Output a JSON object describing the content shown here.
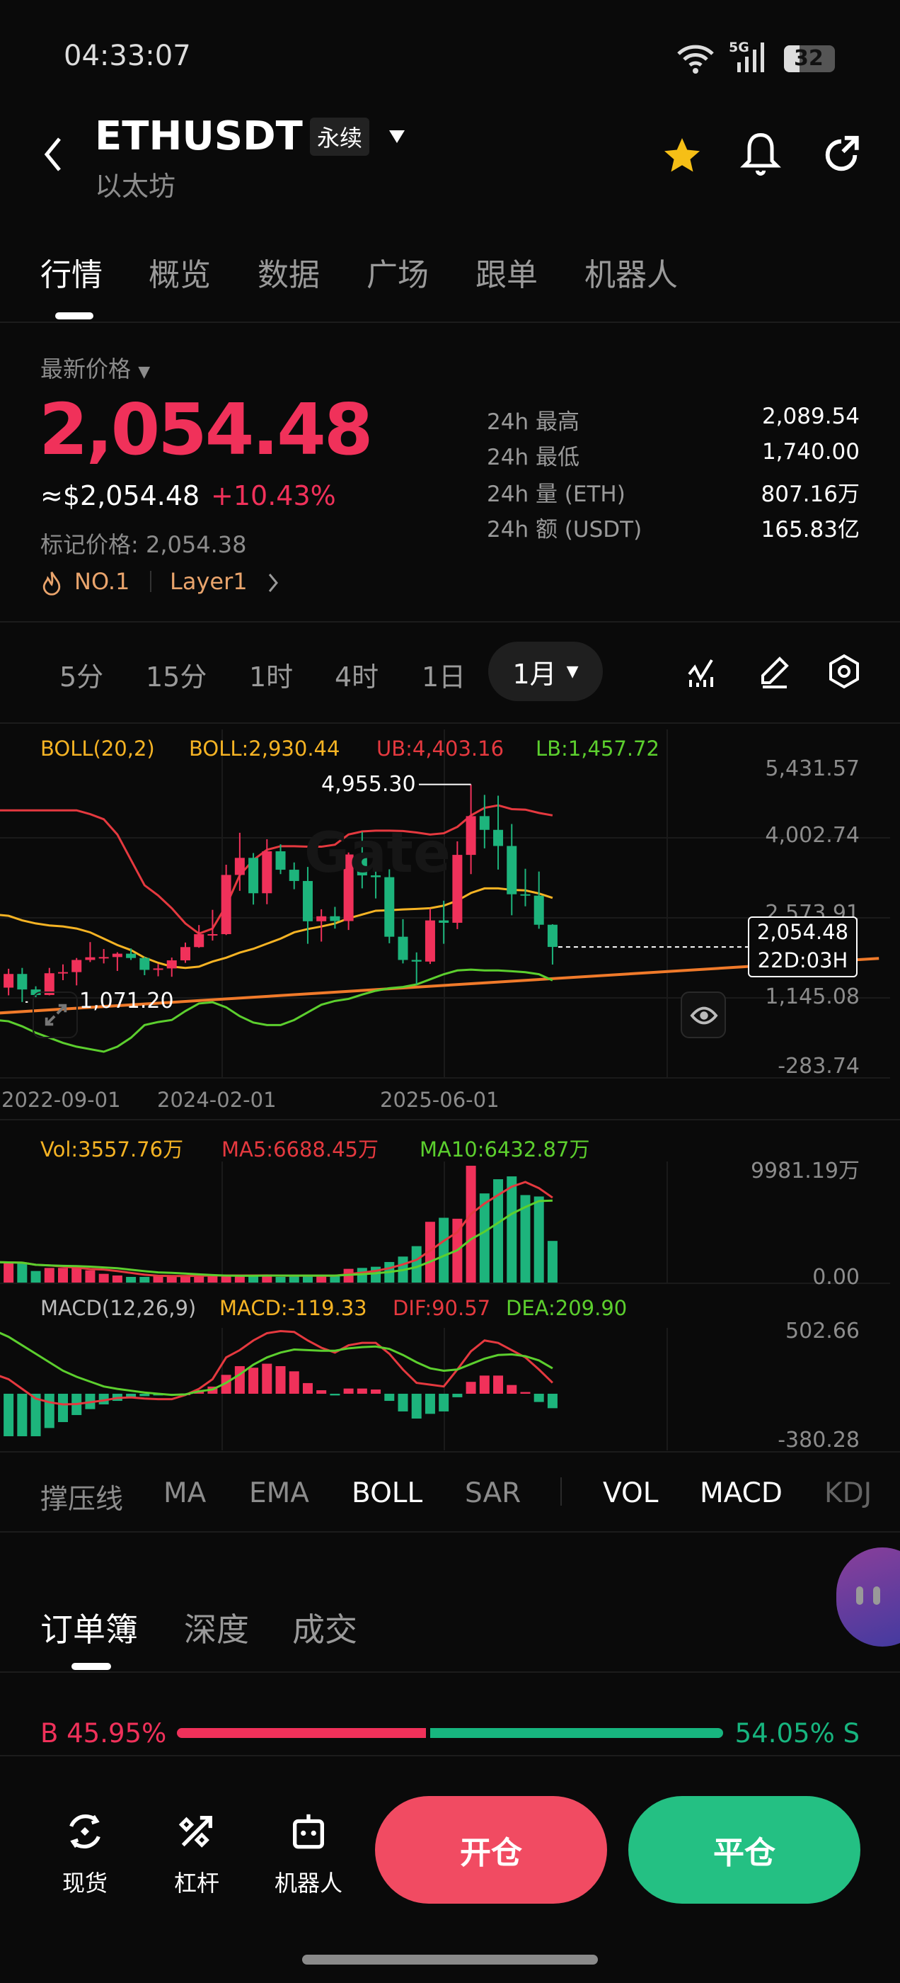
{
  "status_bar": {
    "time": "04:33:07",
    "network": "5G",
    "battery": "32"
  },
  "header": {
    "symbol": "ETHUSDT",
    "contract_type": "永续",
    "name": "以太坊",
    "favorited": true
  },
  "tabs": [
    {
      "label": "行情",
      "active": true
    },
    {
      "label": "概览"
    },
    {
      "label": "数据"
    },
    {
      "label": "广场"
    },
    {
      "label": "跟单"
    },
    {
      "label": "机器人"
    }
  ],
  "price": {
    "label": "最新价格",
    "last": "2,054.48",
    "usd": "≈$2,054.48",
    "change": "+10.43%",
    "mark_label": "标记价格: 2,054.38",
    "rank": "NO.1",
    "category": "Layer1",
    "stats": [
      {
        "label": "24h  最高",
        "value": "2,089.54"
      },
      {
        "label": "24h  最低",
        "value": "1,740.00"
      },
      {
        "label": "24h  量 (ETH)",
        "value": "807.16万"
      },
      {
        "label": "24h  额 (USDT)",
        "value": "165.83亿"
      }
    ]
  },
  "intervals": {
    "items": [
      "5分",
      "15分",
      "1时",
      "4时",
      "1日"
    ],
    "selected": "1月"
  },
  "chart_legend": {
    "boll_name": "BOLL(20,2)",
    "boll": "BOLL:2,930.44",
    "ub": "UB:4,403.16",
    "lb": "LB:1,457.72",
    "vol": "Vol:3557.76万",
    "ma5": "MA5:6688.45万",
    "ma10": "MA10:6432.87万",
    "macd_name": "MACD(12,26,9)",
    "macd": "MACD:-119.33",
    "dif": "DIF:90.57",
    "dea": "DEA:209.90"
  },
  "chart_annotations": {
    "high": "4,955.30",
    "low": "1,071.20",
    "current_price": "2,054.48",
    "countdown": "22D:03H",
    "watermark": "Gate"
  },
  "colors": {
    "up": "#f0315a",
    "down": "#1db47c",
    "ub": "#e5393f",
    "mid": "#f5b324",
    "lb": "#5ccf2e",
    "trend": "#f07a2a",
    "ma5": "#e5393f",
    "ma10": "#5ccf2e",
    "accent_orange": "#e9a46c"
  },
  "chart_data": {
    "type": "candlestick",
    "interval": "1月",
    "price_axis_ticks": [
      "5,431.57",
      "4,002.74",
      "2,573.91",
      "1,145.08",
      "-283.74"
    ],
    "ylim": [
      -283.74,
      5431.57
    ],
    "x_tick_labels": [
      "2022-09-01",
      "2024-02-01",
      "2025-06-01"
    ],
    "dates": [
      "2022-09",
      "2022-10",
      "2022-11",
      "2022-12",
      "2023-01",
      "2023-02",
      "2023-03",
      "2023-04",
      "2023-05",
      "2023-06",
      "2023-07",
      "2023-08",
      "2023-09",
      "2023-10",
      "2023-11",
      "2023-12",
      "2024-01",
      "2024-02",
      "2024-03",
      "2024-04",
      "2024-05",
      "2024-06",
      "2024-07",
      "2024-08",
      "2024-09",
      "2024-10",
      "2024-11",
      "2024-12",
      "2025-01",
      "2025-02",
      "2025-03",
      "2025-04",
      "2025-05",
      "2025-06",
      "2025-07",
      "2025-08",
      "2025-09",
      "2025-10",
      "2025-11",
      "2025-12",
      "2026-01",
      "2026-02"
    ],
    "open": [
      1554,
      1328,
      1572,
      1295,
      1196,
      1585,
      1605,
      1822,
      1870,
      1874,
      1934,
      1857,
      1645,
      1671,
      1815,
      2052,
      2282,
      2283,
      3340,
      3645,
      3013,
      3762,
      3433,
      3232,
      2513,
      2602,
      2517,
      3705,
      3332,
      3300,
      2237,
      1822,
      1793,
      2528,
      2486,
      3698,
      4390,
      4145,
      3857,
      2995,
      2970,
      2451
    ],
    "high": [
      1790,
      1665,
      1680,
      1352,
      1680,
      1743,
      1857,
      2141,
      2018,
      1960,
      2029,
      1876,
      1750,
      1865,
      2133,
      2445,
      2717,
      3523,
      4093,
      3731,
      3977,
      3887,
      3563,
      3483,
      2727,
      2770,
      3740,
      4109,
      3745,
      3440,
      2550,
      1957,
      2738,
      2880,
      3940,
      4955.3,
      4770,
      4755,
      4250,
      3450,
      3400,
      2460
    ],
    "low": [
      1220,
      1190,
      1071.2,
      1157,
      1190,
      1461,
      1368,
      1785,
      1760,
      1626,
      1822,
      1550,
      1530,
      1522,
      1770,
      2040,
      2168,
      2268,
      3056,
      2811,
      2817,
      3355,
      3085,
      2111,
      2150,
      2382,
      2357,
      3100,
      2920,
      2120,
      1760,
      1385,
      1750,
      2111,
      2373,
      3355,
      3815,
      3435,
      2620,
      2780,
      2380,
      1740
    ],
    "close": [
      1328,
      1572,
      1295,
      1196,
      1585,
      1605,
      1822,
      1870,
      1874,
      1934,
      1857,
      1645,
      1671,
      1815,
      2052,
      2282,
      2283,
      3340,
      3645,
      3013,
      3762,
      3433,
      3232,
      2513,
      2602,
      2517,
      3705,
      3332,
      3300,
      2237,
      1822,
      1793,
      2528,
      2486,
      3698,
      4390,
      4145,
      3857,
      2995,
      2970,
      2451,
      2054.48
    ],
    "boll": {
      "ub": [
        4493,
        4493,
        4493,
        4493,
        4493,
        4493,
        4493,
        4425,
        4334,
        4062,
        3608,
        3155,
        2973,
        2746,
        2474,
        2292,
        2383,
        2792,
        3336,
        3608,
        3789,
        3853,
        3853,
        3844,
        3844,
        3880,
        4062,
        4116,
        4130,
        4130,
        4125,
        4098,
        4062,
        4084,
        4198,
        4402,
        4538,
        4583,
        4515,
        4506,
        4447,
        4403.16
      ],
      "mid": [
        2633,
        2610,
        2529,
        2474,
        2438,
        2420,
        2383,
        2315,
        2202,
        2089,
        1998,
        1862,
        1771,
        1703,
        1680,
        1703,
        1794,
        1862,
        1953,
        2021,
        2112,
        2202,
        2315,
        2374,
        2420,
        2474,
        2565,
        2633,
        2701,
        2710,
        2724,
        2733,
        2746,
        2792,
        2882,
        3018,
        3100,
        3100,
        3073,
        3064,
        3009,
        2930.44
      ],
      "lb": [
        750,
        727,
        637,
        523,
        433,
        342,
        274,
        229,
        184,
        274,
        433,
        660,
        714,
        750,
        909,
        1045,
        1068,
        977,
        818,
        705,
        660,
        660,
        750,
        886,
        1023,
        1090,
        1127,
        1204,
        1272,
        1317,
        1340,
        1385,
        1476,
        1567,
        1635,
        1649,
        1635,
        1635,
        1621,
        1603,
        1567,
        1457.72
      ]
    },
    "trendline": [
      {
        "date": "2022-09",
        "price": 870
      },
      {
        "date": "2028-02",
        "price": 1850
      }
    ],
    "volume_wan": [
      1750,
      1697,
      1656,
      990,
      1252,
      1252,
      1252,
      1050,
      747,
      606,
      485,
      485,
      606,
      606,
      606,
      606,
      606,
      606,
      606,
      606,
      646,
      485,
      606,
      606,
      606,
      606,
      1172,
      1252,
      1353,
      1757,
      2222,
      3111,
      5191,
      5535,
      5454,
      9979,
      7615,
      8827,
      9070,
      7474,
      7353,
      3557.76
    ],
    "volume_axis": [
      "9981.19万",
      "0.00"
    ],
    "volume_max": 9981.19,
    "macd": {
      "hist": [
        -351,
        -351,
        -351,
        -351,
        -283,
        -234,
        -176,
        -127,
        -88,
        -59,
        -29,
        -20,
        -14,
        -10,
        0,
        29,
        59,
        156,
        228,
        215,
        248,
        228,
        185,
        88,
        29,
        -14,
        43,
        43,
        35,
        -59,
        -146,
        -205,
        -166,
        -146,
        -29,
        98,
        150,
        150,
        72,
        14,
        -68,
        -119.33
      ],
      "dif": [
        160,
        120,
        40,
        -40,
        -70,
        -88,
        -85,
        -70,
        -55,
        -35,
        -30,
        -40,
        -45,
        -45,
        -10,
        40,
        120,
        300,
        360,
        440,
        500,
        517,
        510,
        440,
        380,
        340,
        400,
        420,
        420,
        330,
        200,
        90,
        75,
        60,
        200,
        350,
        440,
        420,
        360,
        300,
        200,
        90.57
      ],
      "dea": [
        520,
        470,
        400,
        330,
        260,
        190,
        140,
        100,
        60,
        40,
        25,
        10,
        0,
        -10,
        -5,
        20,
        35,
        90,
        160,
        240,
        300,
        340,
        365,
        360,
        355,
        355,
        375,
        385,
        390,
        370,
        320,
        260,
        210,
        190,
        200,
        245,
        290,
        320,
        325,
        310,
        275,
        209.9
      ],
      "axis": [
        "502.66",
        "-380.28"
      ],
      "ylim": [
        -380.28,
        502.66
      ]
    }
  },
  "indicators": [
    {
      "label": "撑压线"
    },
    {
      "label": "MA"
    },
    {
      "label": "EMA"
    },
    {
      "label": "BOLL",
      "active": true
    },
    {
      "label": "SAR"
    },
    {
      "label": "VOL",
      "active": true
    },
    {
      "label": "MACD",
      "active": true
    },
    {
      "label": "KDJ"
    }
  ],
  "book_tabs": [
    {
      "label": "订单簿",
      "active": true
    },
    {
      "label": "深度"
    },
    {
      "label": "成交"
    }
  ],
  "ratio": {
    "buy_label": "B 45.95%",
    "sell_label": "54.05% S",
    "buy_pct": 45.95,
    "sell_pct": 54.05
  },
  "bottom_nav": [
    {
      "label": "现货",
      "icon": "spot-icon"
    },
    {
      "label": "杠杆",
      "icon": "leverage-icon"
    },
    {
      "label": "机器人",
      "icon": "robot-icon"
    }
  ],
  "actions": {
    "open": "开仓",
    "close": "平仓"
  }
}
